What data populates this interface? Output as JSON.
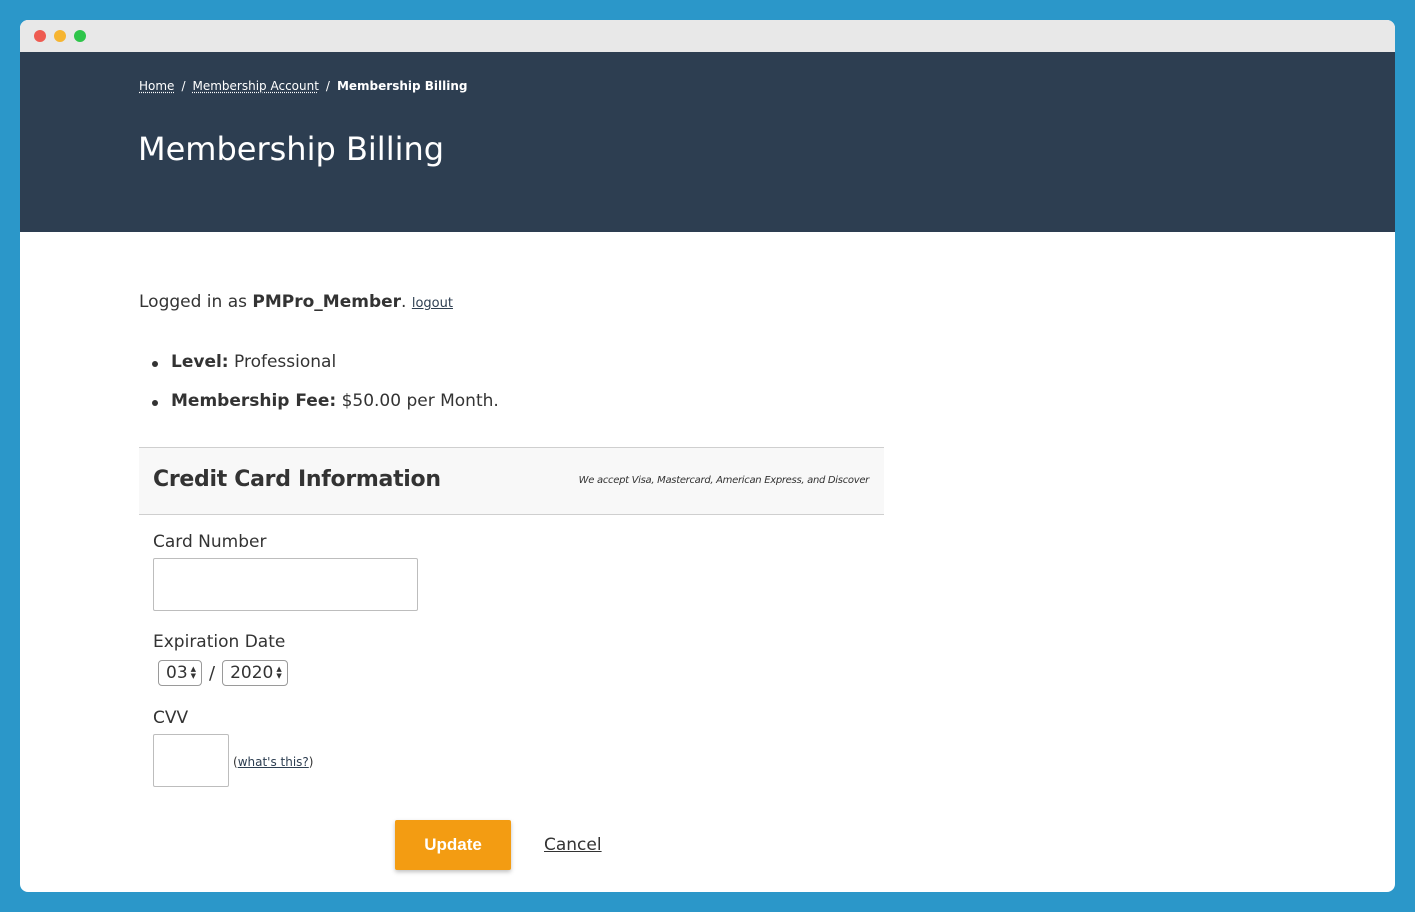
{
  "breadcrumb": {
    "home": "Home",
    "sep": "/",
    "account": "Membership Account",
    "current": "Membership Billing"
  },
  "page": {
    "title": "Membership Billing"
  },
  "user": {
    "prefix": "Logged in as ",
    "name": "PMPro_Member",
    "suffix": ". ",
    "logout": "logout"
  },
  "details": {
    "level_label": "Level:",
    "level_value": " Professional",
    "fee_label": "Membership Fee:",
    "fee_value": " $50.00 per Month."
  },
  "credit_card": {
    "title": "Credit Card Information",
    "accepted": "We accept Visa, Mastercard, American Express, and Discover",
    "card_number_label": "Card Number",
    "card_number_value": "",
    "expiration_label": "Expiration Date",
    "exp_month": "03",
    "exp_sep": "/",
    "exp_year": "2020",
    "cvv_label": "CVV",
    "cvv_value": "",
    "cvv_help_open": "(",
    "cvv_help_link": "what's this?",
    "cvv_help_close": ")"
  },
  "actions": {
    "update": "Update",
    "cancel": "Cancel"
  },
  "colors": {
    "background": "#2b97c9",
    "header": "#2d3e51",
    "button": "#f39c12"
  }
}
